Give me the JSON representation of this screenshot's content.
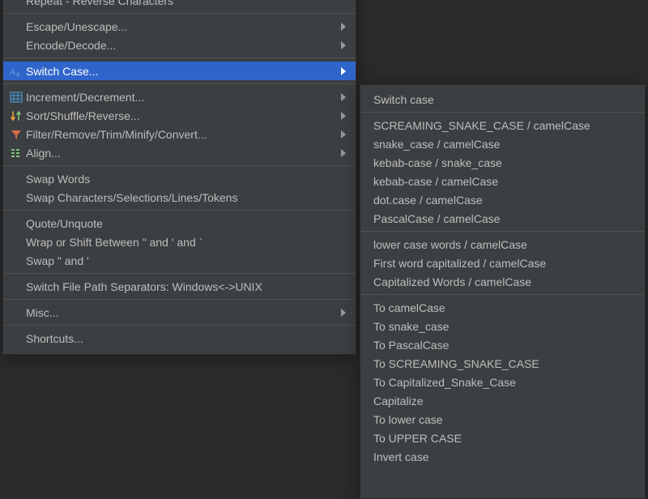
{
  "colors": {
    "menu_bg": "#3c3f41",
    "selected_bg": "#2f65ca",
    "text": "#bdbdbd",
    "text_selected": "#ffffff",
    "separator": "#515151"
  },
  "left_menu": {
    "groups": [
      [
        {
          "label": "Repeat - Reverse Characters",
          "icon": null,
          "submenu": false
        }
      ],
      [
        {
          "label": "Escape/Unescape...",
          "icon": null,
          "submenu": true
        },
        {
          "label": "Encode/Decode...",
          "icon": null,
          "submenu": true
        }
      ],
      [
        {
          "label": "Switch Case...",
          "icon": "switch-case-icon",
          "submenu": true,
          "selected": true
        }
      ],
      [
        {
          "label": "Increment/Decrement...",
          "icon": "grid-icon",
          "submenu": true
        },
        {
          "label": "Sort/Shuffle/Reverse...",
          "icon": "sort-icon",
          "submenu": true
        },
        {
          "label": "Filter/Remove/Trim/Minify/Convert...",
          "icon": "filter-icon",
          "submenu": true
        },
        {
          "label": "Align...",
          "icon": "align-icon",
          "submenu": true
        }
      ],
      [
        {
          "label": "Swap Words",
          "icon": null,
          "submenu": false
        },
        {
          "label": "Swap Characters/Selections/Lines/Tokens",
          "icon": null,
          "submenu": false
        }
      ],
      [
        {
          "label": "Quote/Unquote",
          "icon": null,
          "submenu": false
        },
        {
          "label": "Wrap or Shift Between \" and ' and `",
          "icon": null,
          "submenu": false
        },
        {
          "label": "Swap \" and '",
          "icon": null,
          "submenu": false
        }
      ],
      [
        {
          "label": "Switch File Path Separators: Windows<->UNIX",
          "icon": null,
          "submenu": false
        }
      ],
      [
        {
          "label": "Misc...",
          "icon": null,
          "submenu": true
        }
      ],
      [
        {
          "label": "Shortcuts...",
          "icon": null,
          "submenu": false
        }
      ]
    ]
  },
  "right_menu": {
    "groups": [
      [
        {
          "label": "Switch case"
        }
      ],
      [
        {
          "label": "SCREAMING_SNAKE_CASE / camelCase"
        },
        {
          "label": "snake_case / camelCase"
        },
        {
          "label": "kebab-case / snake_case"
        },
        {
          "label": "kebab-case / camelCase"
        },
        {
          "label": "dot.case / camelCase"
        },
        {
          "label": "PascalCase / camelCase"
        }
      ],
      [
        {
          "label": "lower case words / camelCase"
        },
        {
          "label": "First word capitalized / camelCase"
        },
        {
          "label": "Capitalized Words / camelCase"
        }
      ],
      [
        {
          "label": "To camelCase"
        },
        {
          "label": "To snake_case"
        },
        {
          "label": "To PascalCase"
        },
        {
          "label": "To SCREAMING_SNAKE_CASE"
        },
        {
          "label": "To Capitalized_Snake_Case"
        },
        {
          "label": "Capitalize"
        },
        {
          "label": "To lower case"
        },
        {
          "label": "To UPPER CASE"
        },
        {
          "label": "Invert case"
        }
      ]
    ]
  }
}
